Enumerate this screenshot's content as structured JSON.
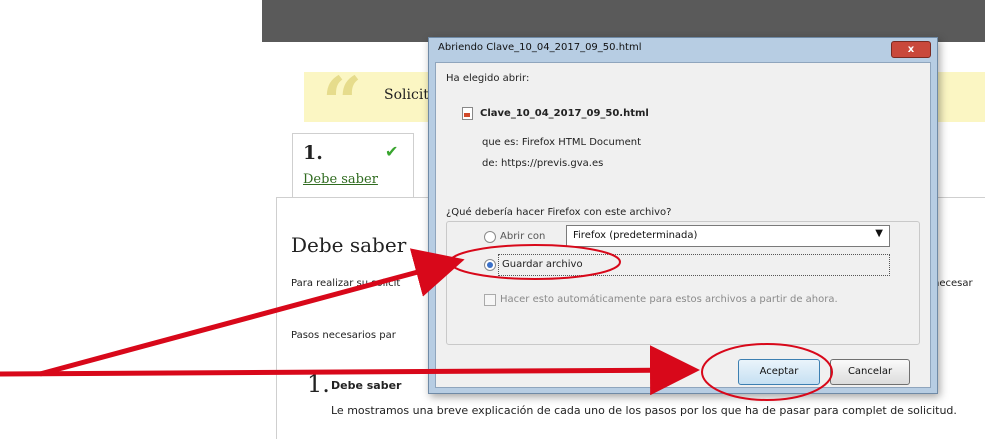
{
  "page": {
    "notice_text": "Solicit",
    "step": {
      "number": "1.",
      "check": "✔",
      "label": "Debe saber"
    },
    "content_title": "Debe saber",
    "para1_left": "Para realizar su solicit",
    "para1_right": "necesar",
    "para2": "Pasos necesarios par",
    "section_number": "1.",
    "section_title": "Debe saber",
    "section_body": "Le mostramos una breve explicación de cada uno de los pasos por los que ha de pasar para complet de solicitud."
  },
  "dialog": {
    "title": "Abriendo Clave_10_04_2017_09_50.html",
    "close": "x",
    "chosen_label": "Ha elegido abrir:",
    "filename": "Clave_10_04_2017_09_50.html",
    "type_line": "que es:  Firefox HTML Document",
    "from_line": "de:  https://previs.gva.es",
    "question": "¿Qué debería hacer Firefox con este archivo?",
    "open_with_label": "Abrir con",
    "open_with_value": "Firefox (predeterminada)",
    "save_label": "Guardar archivo",
    "auto_label": "Hacer esto automáticamente para estos archivos a partir de ahora.",
    "accept_label": "Aceptar",
    "cancel_label": "Cancelar"
  },
  "annotation_color": "#d8081a",
  "icons": {
    "file": "html-file-icon",
    "dropdown": "chevron-down-icon",
    "check": "checkmark-icon"
  }
}
